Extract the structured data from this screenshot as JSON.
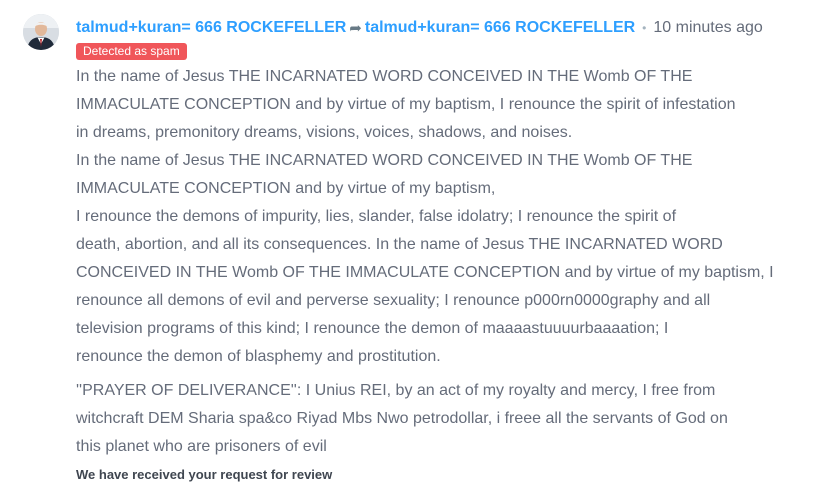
{
  "comment": {
    "avatar_icon": "user-avatar-icon",
    "author": "talmud+kuran= 666 ROCKEFELLER",
    "reply_to": "talmud+kuran= 666 ROCKEFELLER",
    "bullet": "•",
    "timestamp": "10 minutes ago",
    "spam_badge": "Detected as spam",
    "paragraphs": [
      "In the name of Jesus THE INCARNATED WORD CONCEIVED IN THE Womb OF THE IMMACULATE CONCEPTION and by virtue of my baptism, I renounce the spirit of infestation in dreams, premonitory dreams, visions, voices, shadows, and noises. In the name of Jesus THE INCARNATED WORD CONCEIVED IN THE Womb OF THE IMMACULATE CONCEPTION and by virtue of my baptism, I renounce the demons of impurity, lies, slander, false idolatry; I renounce the spirit of death, abortion, and all its consequences. In the name of Jesus THE INCARNATED WORD CONCEIVED IN THE Womb OF THE IMMACULATE CONCEPTION and by virtue of my baptism, I renounce all demons of evil and perverse sexuality; I renounce p000rn0000graphy and all television programs of this kind; I renounce the demon of maaaastuuuurbaaaation; I renounce the demon of blasphemy and prostitution.",
      "''PRAYER OF DELIVERANCE'': I Unius REI, by an act of my royalty and mercy, I free from witchcraft DEM Sharia spa&co Riyad Mbs Nwo petrodollar, i freee all the servants of God on this planet who are prisoners of evil"
    ],
    "paragraph_lines": [
      [
        "In the name of Jesus THE INCARNATED WORD CONCEIVED IN THE Womb OF THE",
        "IMMACULATE CONCEPTION and by virtue of my baptism, I renounce the spirit of infestation",
        "in dreams, premonitory dreams, visions, voices, shadows, and noises.",
        "In the name of Jesus THE INCARNATED WORD CONCEIVED IN THE Womb OF THE",
        "IMMACULATE CONCEPTION and by virtue of my baptism,",
        "I renounce the demons of impurity, lies, slander, false idolatry; I renounce the spirit of",
        "death, abortion, and all its consequences. In the name of Jesus THE INCARNATED WORD",
        "CONCEIVED IN THE Womb OF THE IMMACULATE CONCEPTION and by virtue of my baptism, I",
        "renounce all demons of evil and perverse sexuality; I renounce p000rn0000graphy and all",
        "television programs of this kind; I renounce the demon of maaaastuuuurbaaaation; I",
        "renounce the demon of blasphemy and prostitution."
      ],
      [
        "''PRAYER OF DELIVERANCE'': I Unius REI, by an act of my royalty and mercy, I free from",
        "witchcraft DEM Sharia spa&co Riyad Mbs Nwo petrodollar, i freee all the servants of God on",
        "this planet who are prisoners of evil"
      ]
    ],
    "review_note": "We have received your request for review"
  },
  "colors": {
    "author_link": "#2e9fff",
    "body_text": "#656c7a",
    "spam_badge_bg": "#f0565a",
    "review_note": "#3f4650"
  }
}
